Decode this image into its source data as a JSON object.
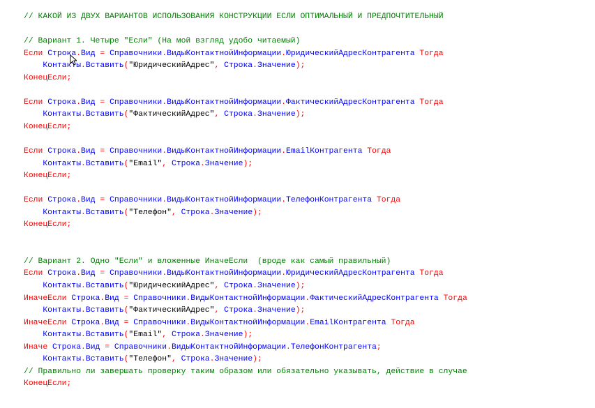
{
  "editor": {
    "colors": {
      "keyword": "#ff0000",
      "comment": "#008000",
      "identifier": "#0000ff",
      "string": "#000000",
      "background": "#ffffff"
    },
    "lines": [
      [
        [
          "c",
          "// КАКОЙ ИЗ ДВУХ ВАРИАНТОВ ИСПОЛЬЗОВАНИЯ КОНСТРУКЦИИ ЕСЛИ ОПТИМАЛЬНЫЙ И ПРЕДПОЧТИТЕЛЬНЫЙ"
        ]
      ],
      [],
      [
        [
          "c",
          "// Вариант 1. Четыре \"Если\" (На мой взгляд удобо читаемый)"
        ]
      ],
      [
        [
          "k",
          "Если "
        ],
        [
          "i",
          "Строка"
        ],
        [
          "o",
          "."
        ],
        [
          "i",
          "Вид"
        ],
        [
          "o",
          " = "
        ],
        [
          "i",
          "Справочники"
        ],
        [
          "o",
          "."
        ],
        [
          "i",
          "ВидыКонтактнойИнформации"
        ],
        [
          "o",
          "."
        ],
        [
          "i",
          "ЮридическийАдресКонтрагента"
        ],
        [
          "k",
          " Тогда"
        ]
      ],
      [
        [
          "t",
          "    "
        ],
        [
          "i",
          "Контакты"
        ],
        [
          "o",
          "."
        ],
        [
          "i",
          "Вставить"
        ],
        [
          "o",
          "("
        ],
        [
          "s",
          "\"ЮридическийАдрес\""
        ],
        [
          "o",
          ", "
        ],
        [
          "i",
          "Строка"
        ],
        [
          "o",
          "."
        ],
        [
          "i",
          "Значение"
        ],
        [
          "o",
          ");"
        ]
      ],
      [
        [
          "k",
          "КонецЕсли;"
        ]
      ],
      [],
      [
        [
          "k",
          "Если "
        ],
        [
          "i",
          "Строка"
        ],
        [
          "o",
          "."
        ],
        [
          "i",
          "Вид"
        ],
        [
          "o",
          " = "
        ],
        [
          "i",
          "Справочники"
        ],
        [
          "o",
          "."
        ],
        [
          "i",
          "ВидыКонтактнойИнформации"
        ],
        [
          "o",
          "."
        ],
        [
          "i",
          "ФактическийАдресКонтрагента"
        ],
        [
          "k",
          " Тогда"
        ]
      ],
      [
        [
          "t",
          "    "
        ],
        [
          "i",
          "Контакты"
        ],
        [
          "o",
          "."
        ],
        [
          "i",
          "Вставить"
        ],
        [
          "o",
          "("
        ],
        [
          "s",
          "\"ФактическийАдрес\""
        ],
        [
          "o",
          ", "
        ],
        [
          "i",
          "Строка"
        ],
        [
          "o",
          "."
        ],
        [
          "i",
          "Значение"
        ],
        [
          "o",
          ");"
        ]
      ],
      [
        [
          "k",
          "КонецЕсли;"
        ]
      ],
      [],
      [
        [
          "k",
          "Если "
        ],
        [
          "i",
          "Строка"
        ],
        [
          "o",
          "."
        ],
        [
          "i",
          "Вид"
        ],
        [
          "o",
          " = "
        ],
        [
          "i",
          "Справочники"
        ],
        [
          "o",
          "."
        ],
        [
          "i",
          "ВидыКонтактнойИнформации"
        ],
        [
          "o",
          "."
        ],
        [
          "i",
          "EmailКонтрагента"
        ],
        [
          "k",
          " Тогда"
        ]
      ],
      [
        [
          "t",
          "    "
        ],
        [
          "i",
          "Контакты"
        ],
        [
          "o",
          "."
        ],
        [
          "i",
          "Вставить"
        ],
        [
          "o",
          "("
        ],
        [
          "s",
          "\"Email\""
        ],
        [
          "o",
          ", "
        ],
        [
          "i",
          "Строка"
        ],
        [
          "o",
          "."
        ],
        [
          "i",
          "Значение"
        ],
        [
          "o",
          ");"
        ]
      ],
      [
        [
          "k",
          "КонецЕсли;"
        ]
      ],
      [],
      [
        [
          "k",
          "Если "
        ],
        [
          "i",
          "Строка"
        ],
        [
          "o",
          "."
        ],
        [
          "i",
          "Вид"
        ],
        [
          "o",
          " = "
        ],
        [
          "i",
          "Справочники"
        ],
        [
          "o",
          "."
        ],
        [
          "i",
          "ВидыКонтактнойИнформации"
        ],
        [
          "o",
          "."
        ],
        [
          "i",
          "ТелефонКонтрагента"
        ],
        [
          "k",
          " Тогда"
        ]
      ],
      [
        [
          "t",
          "    "
        ],
        [
          "i",
          "Контакты"
        ],
        [
          "o",
          "."
        ],
        [
          "i",
          "Вставить"
        ],
        [
          "o",
          "("
        ],
        [
          "s",
          "\"Телефон\""
        ],
        [
          "o",
          ", "
        ],
        [
          "i",
          "Строка"
        ],
        [
          "o",
          "."
        ],
        [
          "i",
          "Значение"
        ],
        [
          "o",
          ");"
        ]
      ],
      [
        [
          "k",
          "КонецЕсли;"
        ]
      ],
      [],
      [],
      [
        [
          "c",
          "// Вариант 2. Одно \"Если\" и вложенные ИначеЕсли  (вроде как самый правильный)"
        ]
      ],
      [
        [
          "k",
          "Если "
        ],
        [
          "i",
          "Строка"
        ],
        [
          "o",
          "."
        ],
        [
          "i",
          "Вид"
        ],
        [
          "o",
          " = "
        ],
        [
          "i",
          "Справочники"
        ],
        [
          "o",
          "."
        ],
        [
          "i",
          "ВидыКонтактнойИнформации"
        ],
        [
          "o",
          "."
        ],
        [
          "i",
          "ЮридическийАдресКонтрагента"
        ],
        [
          "k",
          " Тогда"
        ]
      ],
      [
        [
          "t",
          "    "
        ],
        [
          "i",
          "Контакты"
        ],
        [
          "o",
          "."
        ],
        [
          "i",
          "Вставить"
        ],
        [
          "o",
          "("
        ],
        [
          "s",
          "\"ЮридическийАдрес\""
        ],
        [
          "o",
          ", "
        ],
        [
          "i",
          "Строка"
        ],
        [
          "o",
          "."
        ],
        [
          "i",
          "Значение"
        ],
        [
          "o",
          ");"
        ]
      ],
      [
        [
          "k",
          "ИначеЕсли "
        ],
        [
          "i",
          "Строка"
        ],
        [
          "o",
          "."
        ],
        [
          "i",
          "Вид"
        ],
        [
          "o",
          " = "
        ],
        [
          "i",
          "Справочники"
        ],
        [
          "o",
          "."
        ],
        [
          "i",
          "ВидыКонтактнойИнформации"
        ],
        [
          "o",
          "."
        ],
        [
          "i",
          "ФактическийАдресКонтрагента"
        ],
        [
          "k",
          " Тогда"
        ]
      ],
      [
        [
          "t",
          "    "
        ],
        [
          "i",
          "Контакты"
        ],
        [
          "o",
          "."
        ],
        [
          "i",
          "Вставить"
        ],
        [
          "o",
          "("
        ],
        [
          "s",
          "\"ФактическийАдрес\""
        ],
        [
          "o",
          ", "
        ],
        [
          "i",
          "Строка"
        ],
        [
          "o",
          "."
        ],
        [
          "i",
          "Значение"
        ],
        [
          "o",
          ");"
        ]
      ],
      [
        [
          "k",
          "ИначеЕсли "
        ],
        [
          "i",
          "Строка"
        ],
        [
          "o",
          "."
        ],
        [
          "i",
          "Вид"
        ],
        [
          "o",
          " = "
        ],
        [
          "i",
          "Справочники"
        ],
        [
          "o",
          "."
        ],
        [
          "i",
          "ВидыКонтактнойИнформации"
        ],
        [
          "o",
          "."
        ],
        [
          "i",
          "EmailКонтрагента"
        ],
        [
          "k",
          " Тогда"
        ]
      ],
      [
        [
          "t",
          "    "
        ],
        [
          "i",
          "Контакты"
        ],
        [
          "o",
          "."
        ],
        [
          "i",
          "Вставить"
        ],
        [
          "o",
          "("
        ],
        [
          "s",
          "\"Email\""
        ],
        [
          "o",
          ", "
        ],
        [
          "i",
          "Строка"
        ],
        [
          "o",
          "."
        ],
        [
          "i",
          "Значение"
        ],
        [
          "o",
          ");"
        ]
      ],
      [
        [
          "k",
          "Иначе "
        ],
        [
          "i",
          "Строка"
        ],
        [
          "o",
          "."
        ],
        [
          "i",
          "Вид"
        ],
        [
          "o",
          " = "
        ],
        [
          "i",
          "Справочники"
        ],
        [
          "o",
          "."
        ],
        [
          "i",
          "ВидыКонтактнойИнформации"
        ],
        [
          "o",
          "."
        ],
        [
          "i",
          "ТелефонКонтрагента"
        ],
        [
          "o",
          ";"
        ]
      ],
      [
        [
          "t",
          "    "
        ],
        [
          "i",
          "Контакты"
        ],
        [
          "o",
          "."
        ],
        [
          "i",
          "Вставить"
        ],
        [
          "o",
          "("
        ],
        [
          "s",
          "\"Телефон\""
        ],
        [
          "o",
          ", "
        ],
        [
          "i",
          "Строка"
        ],
        [
          "o",
          "."
        ],
        [
          "i",
          "Значение"
        ],
        [
          "o",
          ");"
        ]
      ],
      [
        [
          "c",
          "// Правильно ли завершать проверку таким образом или обязательно указывать, действие в случае"
        ]
      ],
      [
        [
          "k",
          "КонецЕсли;"
        ]
      ]
    ]
  }
}
